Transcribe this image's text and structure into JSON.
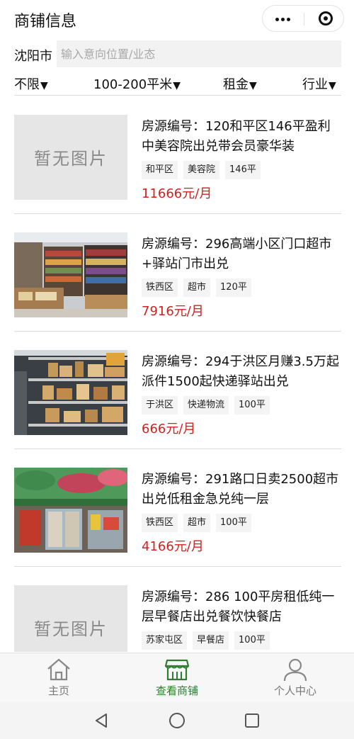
{
  "header": {
    "title": "商铺信息",
    "more_icon": "more-dots-icon",
    "close_icon": "target-icon"
  },
  "search": {
    "city": "沈阳市",
    "placeholder": "输入意向位置/业态",
    "value": ""
  },
  "filters": [
    {
      "label": "不限",
      "arrow": "▼"
    },
    {
      "label": "100-200平米",
      "arrow": "▼"
    },
    {
      "label": "租金",
      "arrow": "▼"
    },
    {
      "label": "行业",
      "arrow": "▼"
    }
  ],
  "listings": [
    {
      "title": "房源编号：120和平区146平盈利中美容院出兑带会员豪华装",
      "tags": [
        "和平区",
        "美容院",
        "146平"
      ],
      "price": "11666元/月",
      "image": "none",
      "no_image_text": "暂无图片"
    },
    {
      "title": "房源编号：296高端小区门口超市+驿站门市出兑",
      "tags": [
        "铁西区",
        "超市",
        "120平"
      ],
      "price": "7916元/月",
      "image": "supermarket-photo"
    },
    {
      "title": "房源编号：294于洪区月赚3.5万起派件1500起快递驿站出兑",
      "tags": [
        "于洪区",
        "快递物流",
        "100平"
      ],
      "price": "666元/月",
      "image": "parcel-shelves-photo"
    },
    {
      "title": "房源编号：291路口日卖2500超市出兑低租金急兑纯一层",
      "tags": [
        "铁西区",
        "超市",
        "100平"
      ],
      "price": "4166元/月",
      "image": "storefront-photo"
    },
    {
      "title": "房源编号：286 100平房租低纯一层早餐店出兑餐饮快餐店",
      "tags": [
        "苏家屯区",
        "早餐店",
        "100平"
      ],
      "price": "",
      "image": "none",
      "no_image_text": "暂无图片"
    }
  ],
  "tabbar": [
    {
      "label": "主页",
      "icon": "home-icon",
      "active": false
    },
    {
      "label": "查看商铺",
      "icon": "store-icon",
      "active": true
    },
    {
      "label": "个人中心",
      "icon": "person-icon",
      "active": false
    }
  ],
  "colors": {
    "price": "#d02020",
    "active_tab": "#2e7d32"
  }
}
